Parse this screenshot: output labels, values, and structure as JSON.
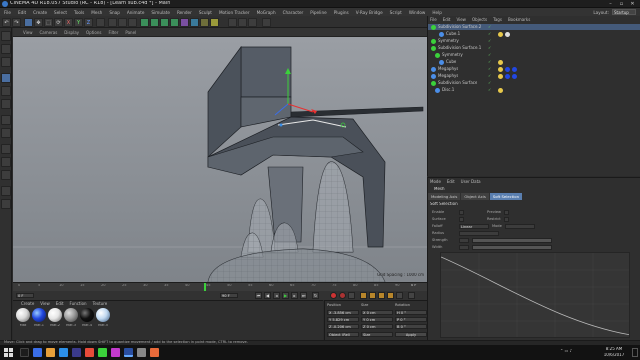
{
  "window": {
    "title": "CINEMA 4D R18.057 Studio (RC - R18) - [Learn sub.c4d *] - Main"
  },
  "menubar": {
    "items": [
      "File",
      "Edit",
      "Create",
      "Select",
      "Tools",
      "Mesh",
      "Snap",
      "Animate",
      "Simulate",
      "Render",
      "Sculpt",
      "Motion Tracker",
      "MoGraph",
      "Character",
      "Pipeline",
      "Plugins",
      "V-Ray Bridge",
      "Script",
      "Window",
      "Help"
    ],
    "layout_label": "Layout:",
    "layout_value": "Startup"
  },
  "toolbar": {
    "undo_label": "↶",
    "redo_label": "↷",
    "x_label": "X",
    "y_label": "Y",
    "z_label": "Z",
    "move_label": "✥",
    "scale_label": "⬚",
    "rotate_label": "⟳"
  },
  "viewport": {
    "menu": [
      "View",
      "Cameras",
      "Display",
      "Options",
      "Filter",
      "Panel"
    ],
    "grid_spacing": "Grid Spacing : 1000 cm"
  },
  "timeline": {
    "ticks": [
      "0",
      "5",
      "10",
      "15",
      "20",
      "25",
      "30",
      "35",
      "40",
      "45",
      "50",
      "55",
      "60",
      "65",
      "70",
      "75",
      "80",
      "85",
      "90"
    ],
    "current_frame": "0 F",
    "start_field": "0 F",
    "end_field": "90 F"
  },
  "materials": {
    "menu": [
      "Create",
      "View",
      "Edit",
      "Function",
      "Texture"
    ],
    "items": [
      {
        "name": "Mat",
        "color": "#d8d8d8"
      },
      {
        "name": "Mat.1",
        "color": "#2247e0"
      },
      {
        "name": "Mat.2",
        "color": "#e6e6e6"
      },
      {
        "name": "Mat.3",
        "color": "#9a9a9a"
      },
      {
        "name": "Mat.4",
        "color": "#111111"
      },
      {
        "name": "Mat.5",
        "color": "#c0d8f0"
      }
    ]
  },
  "coordinates": {
    "headers": [
      "Position",
      "Size",
      "Rotation"
    ],
    "rows": [
      {
        "pos": "X  -3.856 cm",
        "size": "X  0 cm",
        "rot": "H  0 °"
      },
      {
        "pos": "Y  5.829 cm",
        "size": "Y  0 cm",
        "rot": "P  0 °"
      },
      {
        "pos": "Z  -0.206 cm",
        "size": "Z  0 cm",
        "rot": "B  0 °"
      }
    ],
    "mode_select": "Object (Rel)",
    "size_select": "Size",
    "apply_label": "Apply"
  },
  "statusbar": {
    "text": "Move: Click and drag to move elements. Hold down SHIFT to quantize movement / add to the selection in point mode, CTRL to remove."
  },
  "objects": {
    "menu": [
      "File",
      "Edit",
      "View",
      "Objects",
      "Tags",
      "Bookmarks"
    ],
    "rows": [
      {
        "name": "Subdivision Surface.2",
        "indent": 0,
        "selected": true
      },
      {
        "name": "Cube.1",
        "indent": 2
      },
      {
        "name": "Symmetry",
        "indent": 0
      },
      {
        "name": "Subdivision Surface.1",
        "indent": 0
      },
      {
        "name": "Symmetry",
        "indent": 1
      },
      {
        "name": "Cube",
        "indent": 2
      },
      {
        "name": "Megaphys",
        "indent": 0
      },
      {
        "name": "Megaphys",
        "indent": 0
      },
      {
        "name": "Subdivision Surface",
        "indent": 0
      },
      {
        "name": "Disc.1",
        "indent": 1
      }
    ]
  },
  "attributes": {
    "menu": [
      "Mode",
      "Edit",
      "User Data"
    ],
    "title": "Mesh",
    "tabs": [
      "Modeling Axis",
      "Object Axis",
      "Soft Selection"
    ],
    "active_tab": "Soft Selection",
    "section": "Soft Selection",
    "fields": [
      {
        "label": "Enable",
        "value": "",
        "extra_label": "Preview"
      },
      {
        "label": "Surface",
        "value": "",
        "extra_label": "Restrict"
      },
      {
        "label": "Falloff",
        "value": "Linear",
        "extra_label": "Mode"
      },
      {
        "label": "Radius",
        "value": ""
      },
      {
        "label": "Strength",
        "value": ""
      },
      {
        "label": "Width",
        "value": ""
      }
    ]
  },
  "taskbar": {
    "time": "8:25 AM",
    "date": "10/6/2017"
  }
}
